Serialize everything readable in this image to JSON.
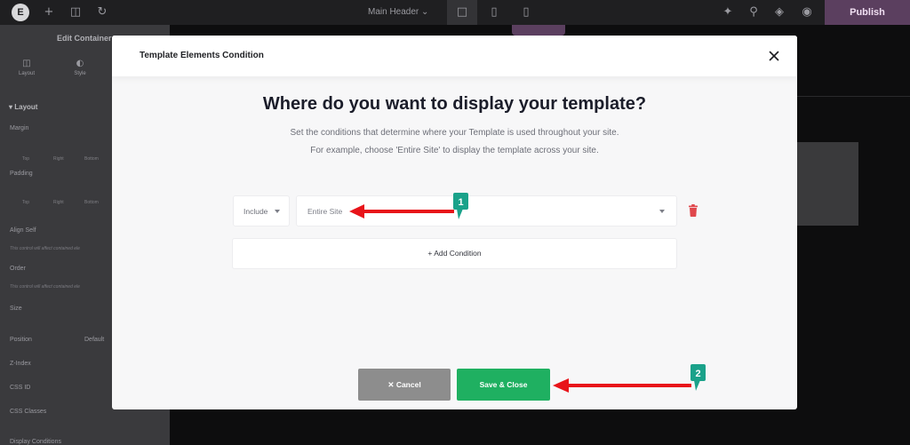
{
  "editor": {
    "logo": "E",
    "document_title": "Main Header",
    "publish_label": "Publish",
    "toolbar_icons": [
      "plus-icon",
      "document-icon",
      "history-icon"
    ],
    "device_icons": [
      "desktop-icon",
      "tablet-icon",
      "mobile-icon"
    ],
    "right_icons": [
      "notifications-icon",
      "search-icon",
      "layers-icon",
      "preview-icon"
    ]
  },
  "sidebar": {
    "panel_title": "Edit Container",
    "tabs": [
      {
        "label": "Layout",
        "icon": "layout-icon"
      },
      {
        "label": "Style",
        "icon": "style-icon"
      }
    ],
    "section_title": "Layout",
    "margin_label": "Margin",
    "margin_subs": [
      "Top",
      "Right",
      "Bottom"
    ],
    "padding_label": "Padding",
    "padding_subs": [
      "Top",
      "Right",
      "Bottom"
    ],
    "align_self_label": "Align Self",
    "align_note": "This control will affect contained ele",
    "order_label": "Order",
    "order_note": "This control will affect contained ele",
    "size_label": "Size",
    "position_label": "Position",
    "position_value": "Default",
    "zindex_label": "Z-Index",
    "cssid_label": "CSS ID",
    "cssclasses_label": "CSS Classes",
    "display_conditions_label": "Display Conditions"
  },
  "modal": {
    "title": "Template Elements Condition",
    "heading": "Where do you want to display your template?",
    "description_line1": "Set the conditions that determine where your Template is used throughout your site.",
    "description_line2": "For example, choose 'Entire Site' to display the template across your site.",
    "condition": {
      "type_value": "Include",
      "location_value": "Entire Site"
    },
    "add_condition_label": "+ Add Condition",
    "cancel_label": "Cancel",
    "save_label": "Save & Close"
  },
  "annotations": {
    "marker1": "1",
    "marker2": "2",
    "arrow_color": "#e8141a",
    "marker_color": "#1aa28a"
  },
  "colors": {
    "save_button": "#1fb061",
    "cancel_button": "#8d8d8d",
    "delete_icon": "#e0474c",
    "publish": "#5b3f5f"
  }
}
